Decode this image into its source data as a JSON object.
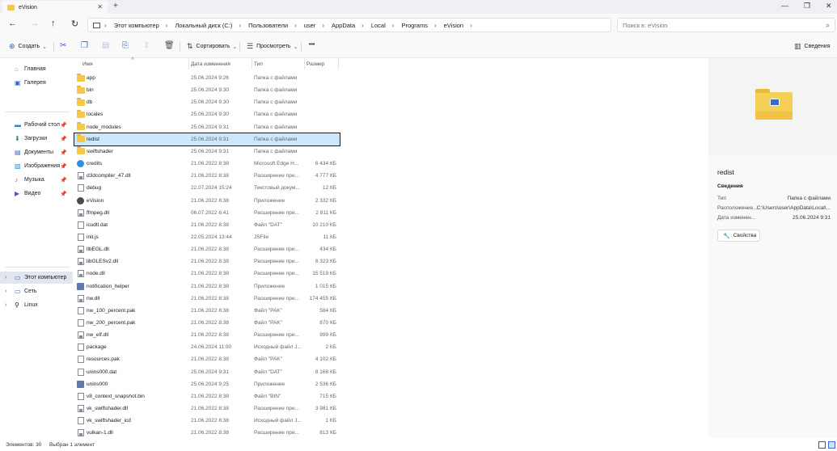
{
  "window": {
    "tab_title": "eVision",
    "tab_close": "✕",
    "new_tab": "+",
    "minimize": "—",
    "maximize": "❐",
    "close": "✕"
  },
  "nav": {
    "back": "←",
    "forward": "→",
    "up": "↑",
    "refresh": "↻",
    "breadcrumbs": [
      "Этот компьютер",
      "Локальный диск (C:)",
      "Пользователи",
      "user",
      "AppData",
      "Local",
      "Programs",
      "eVision"
    ],
    "search_placeholder": "Поиск в: eVision"
  },
  "toolbar": {
    "create": "Создать",
    "sort": "Сортировать",
    "view": "Просмотреть",
    "more": "•••",
    "details": "Сведения"
  },
  "sidebar": {
    "quick": [
      {
        "label": "Главная",
        "icon": "home-icon"
      },
      {
        "label": "Галерея",
        "icon": "gallery-icon"
      }
    ],
    "pinned": [
      {
        "label": "Рабочий стол",
        "icon": "desktop-icon"
      },
      {
        "label": "Загрузки",
        "icon": "downloads-icon"
      },
      {
        "label": "Документы",
        "icon": "documents-icon"
      },
      {
        "label": "Изображения",
        "icon": "pictures-icon"
      },
      {
        "label": "Музыка",
        "icon": "music-icon"
      },
      {
        "label": "Видео",
        "icon": "video-icon"
      }
    ],
    "locations": [
      {
        "label": "Этот компьютер",
        "icon": "computer-icon",
        "selected": true
      },
      {
        "label": "Сеть",
        "icon": "network-icon"
      },
      {
        "label": "Linux",
        "icon": "linux-icon"
      }
    ]
  },
  "columns": {
    "name": "Имя",
    "date": "Дата изменения",
    "type": "Тип",
    "size": "Размер"
  },
  "files": [
    {
      "name": "app",
      "date": "25.06.2024 9:26",
      "type": "Папка с файлами",
      "size": "",
      "icon": "folder"
    },
    {
      "name": "bin",
      "date": "25.06.2024 9:30",
      "type": "Папка с файлами",
      "size": "",
      "icon": "folder"
    },
    {
      "name": "db",
      "date": "25.06.2024 9:30",
      "type": "Папка с файлами",
      "size": "",
      "icon": "folder"
    },
    {
      "name": "locales",
      "date": "25.06.2024 9:30",
      "type": "Папка с файлами",
      "size": "",
      "icon": "folder"
    },
    {
      "name": "node_modules",
      "date": "25.06.2024 9:31",
      "type": "Папка с файлами",
      "size": "",
      "icon": "folder"
    },
    {
      "name": "redist",
      "date": "25.06.2024 9:31",
      "type": "Папка с файлами",
      "size": "",
      "icon": "folder",
      "selected": true
    },
    {
      "name": "swiftshader",
      "date": "25.06.2024 9:31",
      "type": "Папка с файлами",
      "size": "",
      "icon": "folder"
    },
    {
      "name": "credits",
      "date": "21.06.2022 8:38",
      "type": "Microsoft Edge H...",
      "size": "6 434 КБ",
      "icon": "edge"
    },
    {
      "name": "d3dcompiler_47.dll",
      "date": "21.06.2022 8:38",
      "type": "Расширение при...",
      "size": "4 777 КБ",
      "icon": "dll"
    },
    {
      "name": "debug",
      "date": "22.07.2024 15:24",
      "type": "Текстовый докум...",
      "size": "12 КБ",
      "icon": "doc"
    },
    {
      "name": "eVision",
      "date": "21.06.2022 8:38",
      "type": "Приложение",
      "size": "2 332 КБ",
      "icon": "app"
    },
    {
      "name": "ffmpeg.dll",
      "date": "06.07.2022 6:41",
      "type": "Расширение при...",
      "size": "2 811 КБ",
      "icon": "dll"
    },
    {
      "name": "icudtl.dat",
      "date": "21.06.2022 8:38",
      "type": "Файл \"DAT\"",
      "size": "10 210 КБ",
      "icon": "doc"
    },
    {
      "name": "init.js",
      "date": "22.05.2024 13:44",
      "type": "JSFile",
      "size": "11 КБ",
      "icon": "doc"
    },
    {
      "name": "libEGL.dll",
      "date": "21.06.2022 8:38",
      "type": "Расширение при...",
      "size": "434 КБ",
      "icon": "dll"
    },
    {
      "name": "libGLESv2.dll",
      "date": "21.06.2022 8:38",
      "type": "Расширение при...",
      "size": "6 323 КБ",
      "icon": "dll"
    },
    {
      "name": "node.dll",
      "date": "21.06.2022 8:38",
      "type": "Расширение при...",
      "size": "15 519 КБ",
      "icon": "dll"
    },
    {
      "name": "notification_helper",
      "date": "21.06.2022 8:38",
      "type": "Приложение",
      "size": "1 015 КБ",
      "icon": "exe"
    },
    {
      "name": "nw.dll",
      "date": "21.06.2022 8:38",
      "type": "Расширение при...",
      "size": "174 455 КБ",
      "icon": "dll"
    },
    {
      "name": "nw_100_percent.pak",
      "date": "21.06.2022 8:38",
      "type": "Файл \"PAK\"",
      "size": "584 КБ",
      "icon": "doc"
    },
    {
      "name": "nw_200_percent.pak",
      "date": "21.06.2022 8:38",
      "type": "Файл \"PAK\"",
      "size": "870 КБ",
      "icon": "doc"
    },
    {
      "name": "nw_elf.dll",
      "date": "21.06.2022 8:38",
      "type": "Расширение при...",
      "size": "999 КБ",
      "icon": "dll"
    },
    {
      "name": "package",
      "date": "24.06.2024 11:00",
      "type": "Исходный файл J...",
      "size": "2 КБ",
      "icon": "doc"
    },
    {
      "name": "resources.pak",
      "date": "21.06.2022 8:38",
      "type": "Файл \"PAK\"",
      "size": "4 102 КБ",
      "icon": "doc"
    },
    {
      "name": "unins000.dat",
      "date": "25.06.2024 9:31",
      "type": "Файл \"DAT\"",
      "size": "8 168 КБ",
      "icon": "doc"
    },
    {
      "name": "unins000",
      "date": "25.06.2024 9:25",
      "type": "Приложение",
      "size": "2 536 КБ",
      "icon": "exe"
    },
    {
      "name": "v8_context_snapshot.bin",
      "date": "21.06.2022 8:38",
      "type": "Файл \"BIN\"",
      "size": "715 КБ",
      "icon": "doc"
    },
    {
      "name": "vk_swiftshader.dll",
      "date": "21.06.2022 8:38",
      "type": "Расширение при...",
      "size": "3 981 КБ",
      "icon": "dll"
    },
    {
      "name": "vk_swiftshader_icd",
      "date": "21.06.2022 8:38",
      "type": "Исходный файл J...",
      "size": "1 КБ",
      "icon": "doc"
    },
    {
      "name": "vulkan-1.dll",
      "date": "21.06.2022 8:38",
      "type": "Расширение при...",
      "size": "813 КБ",
      "icon": "dll"
    }
  ],
  "details_pane": {
    "name": "redist",
    "section": "Сведения",
    "props": [
      {
        "key": "Тип",
        "value": "Папка с файлами"
      },
      {
        "key": "Расположение...",
        "value": "C:\\Users\\user\\AppData\\Local\\..."
      },
      {
        "key": "Дата изменен...",
        "value": "25.06.2024 9:31"
      }
    ],
    "properties_button": "Свойства"
  },
  "status": {
    "count": "Элементов: 30",
    "selected": "Выбран 1 элемент"
  }
}
